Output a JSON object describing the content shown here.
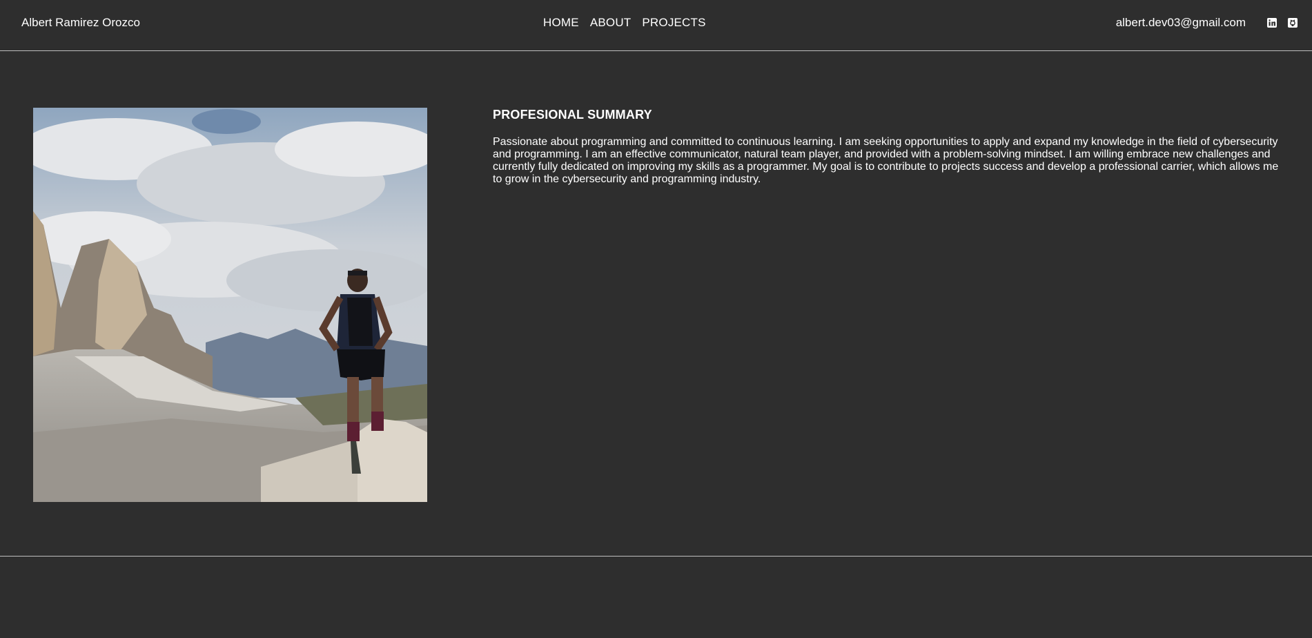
{
  "header": {
    "brand": "Albert Ramirez Orozco",
    "nav": [
      "HOME",
      "ABOUT",
      "PROJECTS"
    ],
    "email": "albert.dev03@gmail.com",
    "icons": [
      "linkedin-icon",
      "github-icon"
    ]
  },
  "summary": {
    "title": "PROFESIONAL SUMMARY",
    "text": "Passionate about programming and committed to continuous learning. I am seeking opportunities to apply and expand my knowledge in the field of cybersecurity and programming. I am an effective communicator, natural team player, and provided with a problem-solving mindset. I am willing embrace new challenges and currently fully dedicated on improving my skills as a programmer. My goal is to contribute to projects success and develop a professional carrier, which allows me to grow in the cybersecurity and programming industry."
  },
  "colors": {
    "background": "#2e2e2e",
    "text": "#ffffff",
    "divider": "#bfbfbf"
  }
}
